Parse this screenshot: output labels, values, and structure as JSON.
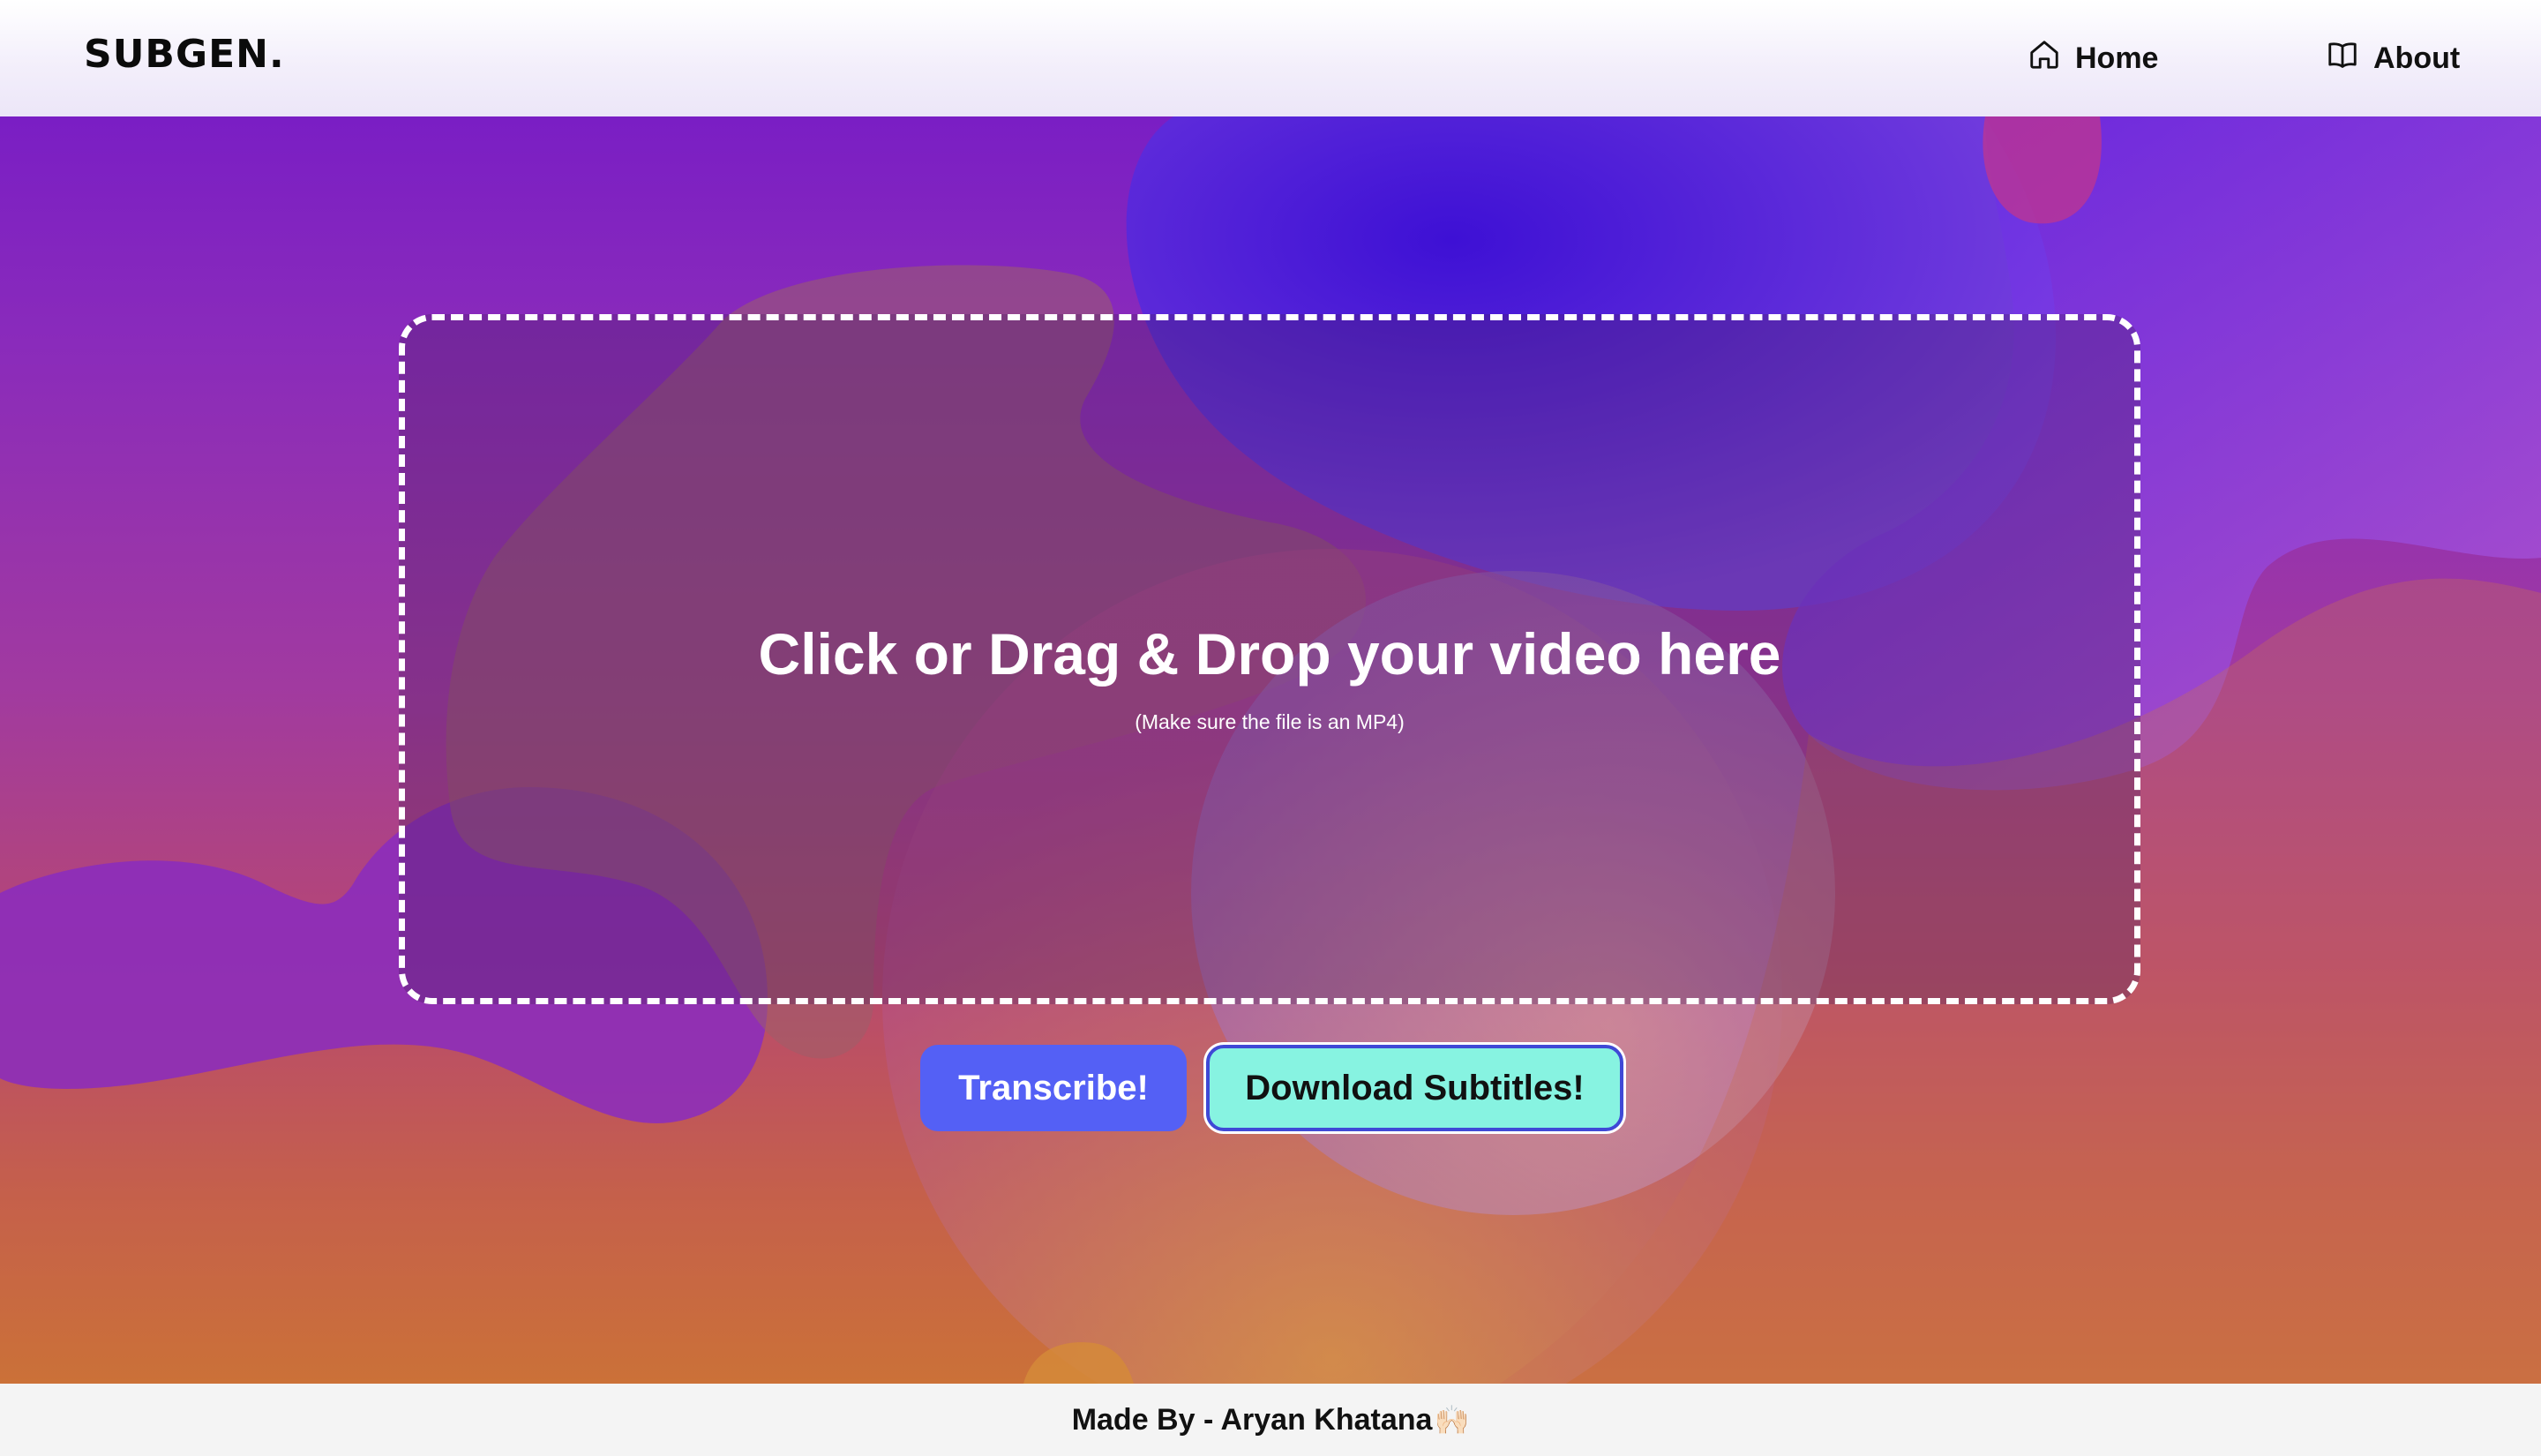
{
  "navbar": {
    "logo": "SUBGEN.",
    "links": [
      {
        "label": "Home",
        "icon": "home-icon"
      },
      {
        "label": "About",
        "icon": "book-icon"
      }
    ]
  },
  "upload": {
    "title": "Click or Drag & Drop your video here",
    "subtitle": "(Make sure the file is an MP4)"
  },
  "actions": {
    "transcribe_label": "Transcribe!",
    "download_label": "Download Subtitles!"
  },
  "footer": {
    "text": "Made By - Aryan Khatana",
    "emoji": "🙌🏻"
  },
  "colors": {
    "transcribe_button": "#5460f5",
    "download_button": "#87f3e1",
    "download_border": "#3f49d6",
    "hero_top": "#7a1ec4",
    "hero_bottom": "#cb7138"
  }
}
